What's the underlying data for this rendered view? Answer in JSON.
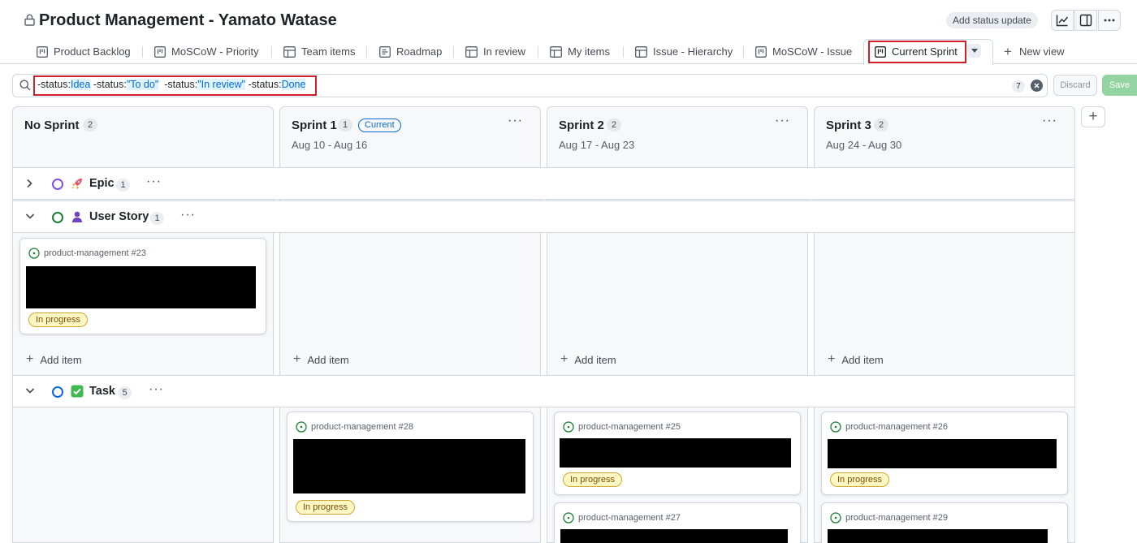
{
  "header": {
    "title": "Product Management - Yamato Watase",
    "status_button": "Add status update"
  },
  "tabs": [
    {
      "label": "Product Backlog",
      "icon": "board-icon"
    },
    {
      "label": "MoSCoW - Priority",
      "icon": "board-icon"
    },
    {
      "label": "Team items",
      "icon": "table-icon"
    },
    {
      "label": "Roadmap",
      "icon": "roadmap-icon"
    },
    {
      "label": "In review",
      "icon": "table-icon"
    },
    {
      "label": "My items",
      "icon": "table-icon"
    },
    {
      "label": "Issue - Hierarchy",
      "icon": "table-icon"
    },
    {
      "label": "MoSCoW - Issue",
      "icon": "board-icon"
    },
    {
      "label": "Current Sprint",
      "icon": "board-icon",
      "active": true
    }
  ],
  "new_view": "New view",
  "filter": {
    "parts": [
      {
        "t": "-status:",
        "v": false
      },
      {
        "t": "Idea",
        "v": true
      },
      {
        "t": " -status:",
        "v": false
      },
      {
        "t": "\"To do\"",
        "v": true
      },
      {
        "t": "  -status:",
        "v": false
      },
      {
        "t": "\"In review\"",
        "v": true
      },
      {
        "t": " -status:",
        "v": false
      },
      {
        "t": "Done",
        "v": true
      }
    ],
    "count": "7",
    "discard": "Discard",
    "save": "Save"
  },
  "columns": [
    {
      "name": "No Sprint",
      "count": "2",
      "dates": ""
    },
    {
      "name": "Sprint 1",
      "count": "1",
      "badge": "Current",
      "dates": "Aug 10 - Aug 16"
    },
    {
      "name": "Sprint 2",
      "count": "2",
      "dates": "Aug 17 - Aug 23"
    },
    {
      "name": "Sprint 3",
      "count": "2",
      "dates": "Aug 24 - Aug 30"
    }
  ],
  "groups": [
    {
      "name": "Epic",
      "count": "1",
      "status_color": "#8250df",
      "emoji": "rocket"
    },
    {
      "name": "User Story",
      "count": "1",
      "status_color": "#1a7f37",
      "emoji": "bust-in-silhouette"
    },
    {
      "name": "Task",
      "count": "5",
      "status_color": "#0969da",
      "emoji": "check-mark-button"
    }
  ],
  "add_item": "Add item",
  "cards": {
    "story_23": {
      "ref": "product-management #23",
      "status": "In progress"
    },
    "task_28": {
      "ref": "product-management #28",
      "status": "In progress"
    },
    "task_25": {
      "ref": "product-management #25",
      "status": "In progress"
    },
    "task_26": {
      "ref": "product-management #26",
      "status": "In progress"
    },
    "task_27": {
      "ref": "product-management #27"
    },
    "task_29": {
      "ref": "product-management #29"
    }
  }
}
